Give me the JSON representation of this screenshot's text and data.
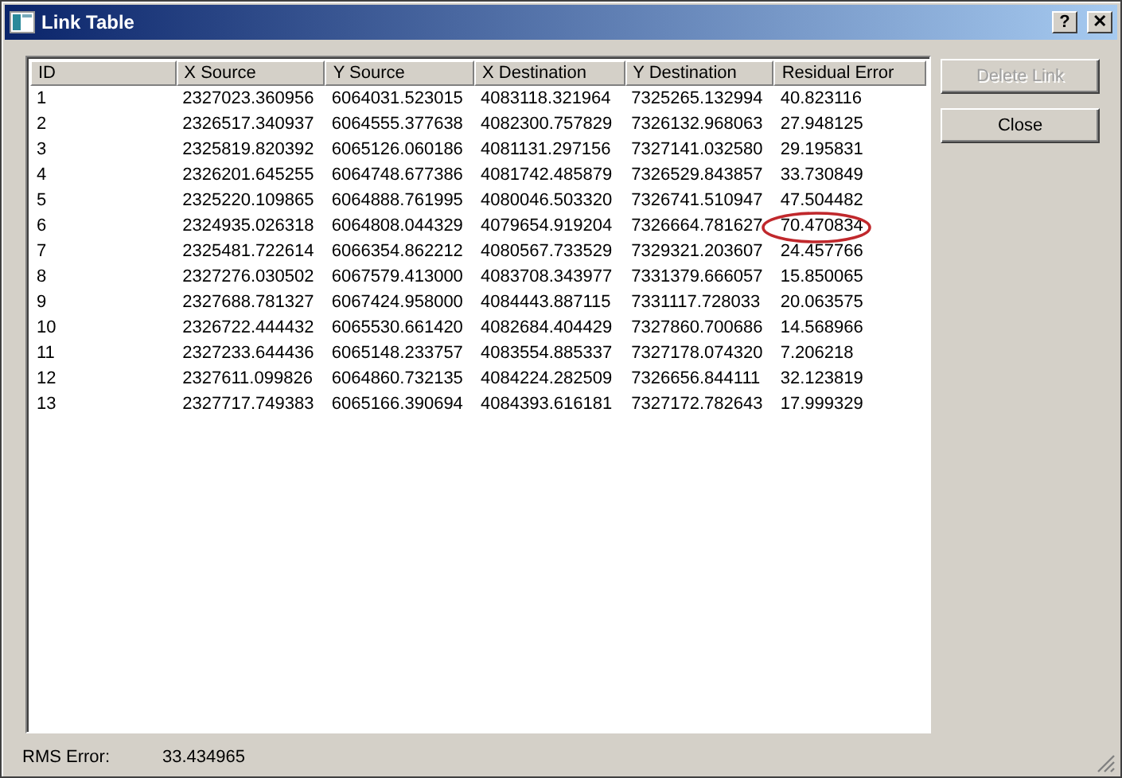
{
  "window": {
    "title": "Link Table",
    "help_button": "?",
    "close_button": "✕"
  },
  "table": {
    "columns": [
      "ID",
      "X Source",
      "Y Source",
      "X Destination",
      "Y Destination",
      "Residual Error"
    ],
    "rows": [
      {
        "cells": [
          "1",
          "2327023.360956",
          "6064031.523015",
          "4083118.321964",
          "7325265.132994",
          "40.823116"
        ],
        "circled": false
      },
      {
        "cells": [
          "2",
          "2326517.340937",
          "6064555.377638",
          "4082300.757829",
          "7326132.968063",
          "27.948125"
        ],
        "circled": false
      },
      {
        "cells": [
          "3",
          "2325819.820392",
          "6065126.060186",
          "4081131.297156",
          "7327141.032580",
          "29.195831"
        ],
        "circled": false
      },
      {
        "cells": [
          "4",
          "2326201.645255",
          "6064748.677386",
          "4081742.485879",
          "7326529.843857",
          "33.730849"
        ],
        "circled": false
      },
      {
        "cells": [
          "5",
          "2325220.109865",
          "6064888.761995",
          "4080046.503320",
          "7326741.510947",
          "47.504482"
        ],
        "circled": false
      },
      {
        "cells": [
          "6",
          "2324935.026318",
          "6064808.044329",
          "4079654.919204",
          "7326664.781627",
          "70.470834"
        ],
        "circled": true
      },
      {
        "cells": [
          "7",
          "2325481.722614",
          "6066354.862212",
          "4080567.733529",
          "7329321.203607",
          "24.457766"
        ],
        "circled": false
      },
      {
        "cells": [
          "8",
          "2327276.030502",
          "6067579.413000",
          "4083708.343977",
          "7331379.666057",
          "15.850065"
        ],
        "circled": false
      },
      {
        "cells": [
          "9",
          "2327688.781327",
          "6067424.958000",
          "4084443.887115",
          "7331117.728033",
          "20.063575"
        ],
        "circled": false
      },
      {
        "cells": [
          "10",
          "2326722.444432",
          "6065530.661420",
          "4082684.404429",
          "7327860.700686",
          "14.568966"
        ],
        "circled": false
      },
      {
        "cells": [
          "11",
          "2327233.644436",
          "6065148.233757",
          "4083554.885337",
          "7327178.074320",
          "7.206218"
        ],
        "circled": false
      },
      {
        "cells": [
          "12",
          "2327611.099826",
          "6064860.732135",
          "4084224.282509",
          "7326656.844111",
          "32.123819"
        ],
        "circled": false
      },
      {
        "cells": [
          "13",
          "2327717.749383",
          "6065166.390694",
          "4084393.616181",
          "7327172.782643",
          "17.999329"
        ],
        "circled": false
      }
    ]
  },
  "buttons": [
    {
      "label": "Delete Link",
      "disabled": true
    },
    {
      "label": "Close",
      "disabled": false
    }
  ],
  "status": {
    "label": "RMS Error:",
    "value": "33.434965"
  }
}
